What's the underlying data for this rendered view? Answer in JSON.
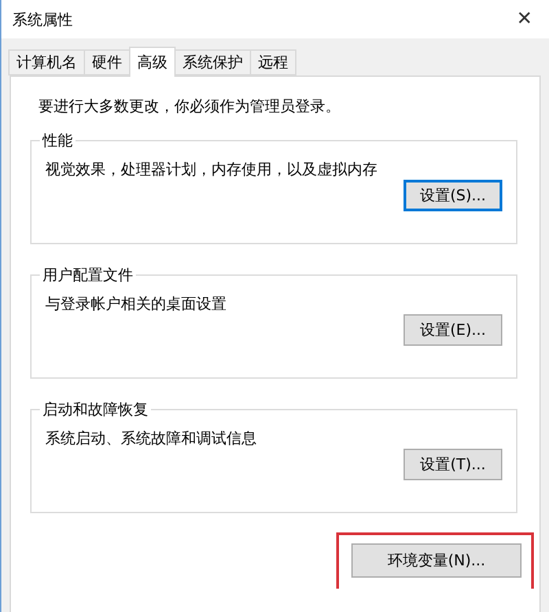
{
  "window": {
    "title": "系统属性",
    "close": "✕"
  },
  "tabs": [
    {
      "label": "计算机名",
      "selected": false
    },
    {
      "label": "硬件",
      "selected": false
    },
    {
      "label": "高级",
      "selected": true
    },
    {
      "label": "系统保护",
      "selected": false
    },
    {
      "label": "远程",
      "selected": false
    }
  ],
  "notice": "要进行大多数更改，你必须作为管理员登录。",
  "groups": [
    {
      "title": "性能",
      "description": "视觉效果，处理器计划，内存使用，以及虚拟内存",
      "button": {
        "label": "设置(S)...",
        "focused": true
      }
    },
    {
      "title": "用户配置文件",
      "description": "与登录帐户相关的桌面设置",
      "button": {
        "label": "设置(E)...",
        "focused": false
      }
    },
    {
      "title": "启动和故障恢复",
      "description": "系统启动、系统故障和调试信息",
      "button": {
        "label": "设置(T)...",
        "focused": false
      }
    }
  ],
  "bottom_button": {
    "label": "环境变量(N)...",
    "highlighted": true
  }
}
